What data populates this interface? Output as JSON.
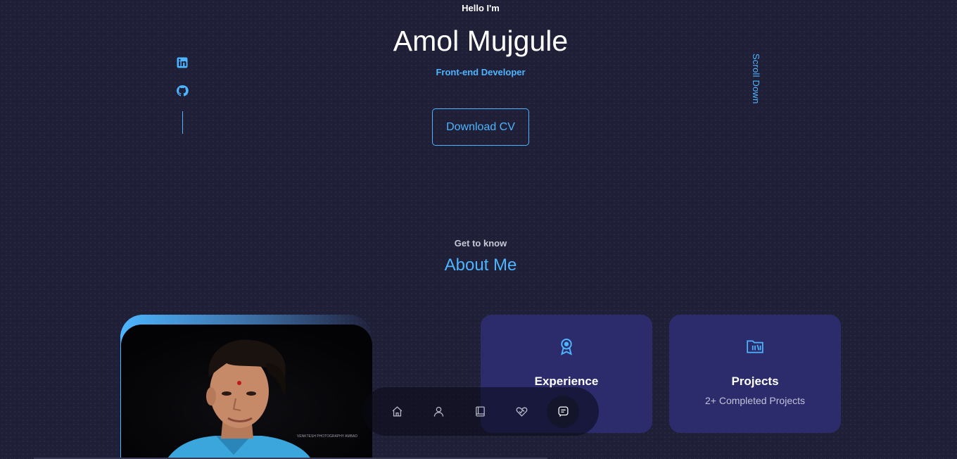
{
  "header": {
    "greeting": "Hello I'm",
    "name": "Amol Mujgule",
    "role": "Front-end Developer",
    "cv_button": "Download CV"
  },
  "socials": [
    {
      "name": "linkedin-icon"
    },
    {
      "name": "github-icon"
    }
  ],
  "scroll": {
    "label": "Scroll Down"
  },
  "about": {
    "subtitle": "Get to know",
    "title": "About Me",
    "image_watermark": "VENKTESH PHOTOGRAPHY AMBAD",
    "cards": [
      {
        "icon": "award-icon",
        "title": "Experience",
        "text": ""
      },
      {
        "icon": "folder-icon",
        "title": "Projects",
        "text": "2+ Completed Projects"
      }
    ]
  },
  "nav": {
    "items": [
      "home-icon",
      "user-icon",
      "book-icon",
      "services-icon",
      "message-icon"
    ],
    "active": "message-icon"
  },
  "colors": {
    "background": "#1f1f38",
    "accent": "#4db5ff",
    "card": "#2c2c6c"
  }
}
